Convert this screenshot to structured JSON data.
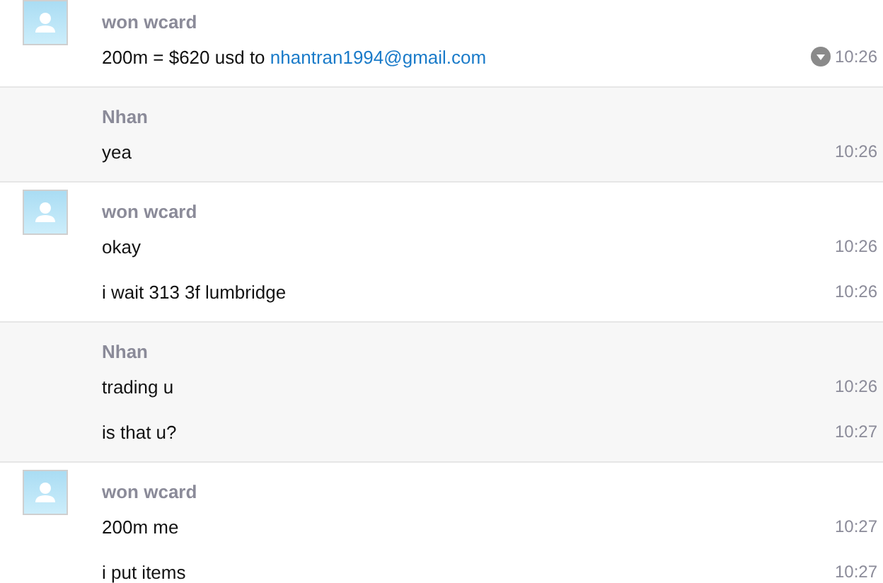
{
  "groups": [
    {
      "sender": "won wcard",
      "avatar": true,
      "color": "#ffffff",
      "messages": [
        {
          "parts": [
            {
              "kind": "text",
              "text": "200m = $620 usd to "
            },
            {
              "kind": "link",
              "text": "nhantran1994@gmail.com"
            }
          ],
          "time": "10:26",
          "menu": true
        }
      ]
    },
    {
      "sender": "Nhan",
      "avatar": false,
      "color": "#f7f7f7",
      "messages": [
        {
          "parts": [
            {
              "kind": "text",
              "text": "yea"
            }
          ],
          "time": "10:26",
          "menu": false
        }
      ]
    },
    {
      "sender": "won wcard",
      "avatar": true,
      "color": "#ffffff",
      "messages": [
        {
          "parts": [
            {
              "kind": "text",
              "text": "okay"
            }
          ],
          "time": "10:26",
          "menu": false
        },
        {
          "parts": [
            {
              "kind": "text",
              "text": "i wait 313 3f lumbridge"
            }
          ],
          "time": "10:26",
          "menu": false
        }
      ]
    },
    {
      "sender": "Nhan",
      "avatar": false,
      "color": "#f7f7f7",
      "messages": [
        {
          "parts": [
            {
              "kind": "text",
              "text": "trading u"
            }
          ],
          "time": "10:26",
          "menu": false
        },
        {
          "parts": [
            {
              "kind": "text",
              "text": "is that u?"
            }
          ],
          "time": "10:27",
          "menu": false
        }
      ]
    },
    {
      "sender": "won wcard",
      "avatar": true,
      "color": "#ffffff",
      "messages": [
        {
          "parts": [
            {
              "kind": "text",
              "text": "200m me"
            }
          ],
          "time": "10:27",
          "menu": false
        },
        {
          "parts": [
            {
              "kind": "text",
              "text": "i put items"
            }
          ],
          "time": "10:27",
          "menu": false
        }
      ]
    }
  ]
}
